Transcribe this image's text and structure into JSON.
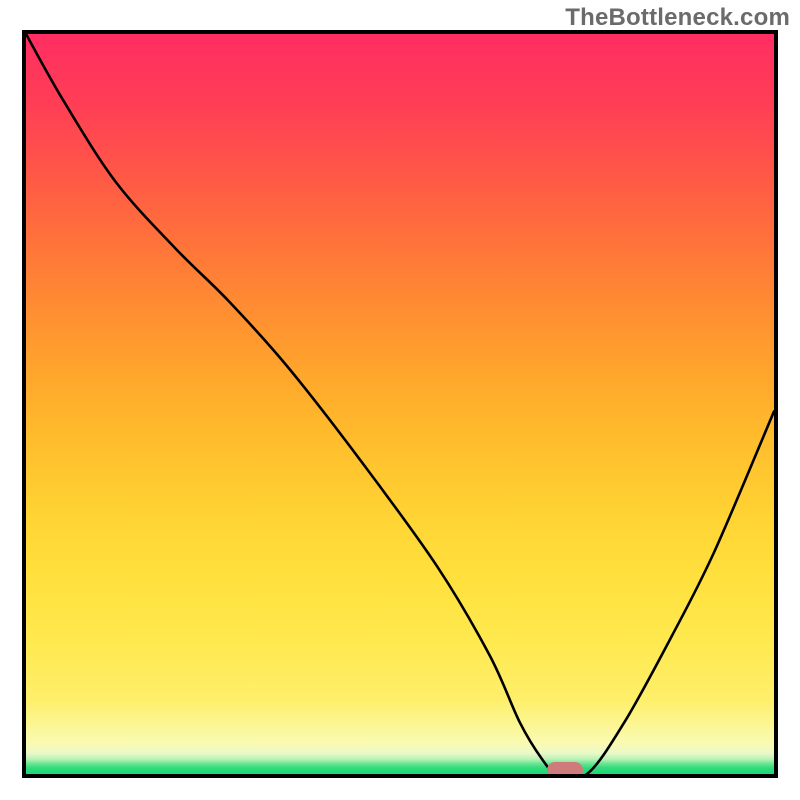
{
  "watermark": "TheBottleneck.com",
  "chart_data": {
    "type": "line",
    "title": "",
    "xlabel": "",
    "ylabel": "",
    "x_range": [
      0,
      100
    ],
    "y_range": [
      0,
      100
    ],
    "series": [
      {
        "name": "bottleneck-curve",
        "x": [
          0,
          5,
          12,
          20,
          27,
          35,
          45,
          55,
          62,
          66,
          69,
          71,
          75,
          80,
          86,
          92,
          100
        ],
        "y": [
          100,
          91,
          80,
          71,
          64,
          55,
          42,
          28,
          16,
          7,
          2,
          0,
          0,
          7,
          18,
          30,
          49
        ]
      }
    ],
    "background_gradient": {
      "direction": "vertical",
      "stops": [
        {
          "pos": 0.0,
          "color": "#1bd877"
        },
        {
          "pos": 0.03,
          "color": "#e9f9c8"
        },
        {
          "pos": 0.18,
          "color": "#ffe94f"
        },
        {
          "pos": 0.5,
          "color": "#ffb12b"
        },
        {
          "pos": 0.8,
          "color": "#ff5d42"
        },
        {
          "pos": 1.0,
          "color": "#ff2e62"
        }
      ]
    },
    "marker": {
      "x": 72,
      "y": 0,
      "color": "#cf7b7b",
      "shape": "pill"
    }
  },
  "plot": {
    "inner_w": 748,
    "inner_h": 740
  }
}
